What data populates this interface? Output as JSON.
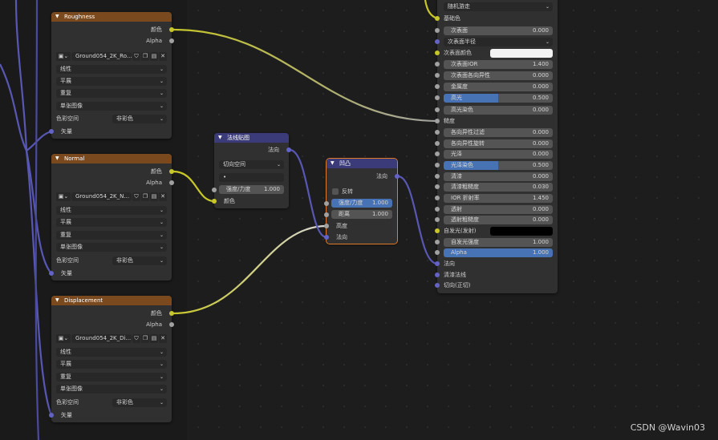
{
  "colors": {
    "texture_header": "#7a4a1e",
    "vector_header": "#3b3b79",
    "socket_color": "#c7c729",
    "socket_vector": "#6363c7",
    "socket_float": "#a1a1a1",
    "active_field": "#4772b3"
  },
  "roughness": {
    "title": "Roughness",
    "out_color": "颜色",
    "out_alpha": "Alpha",
    "image_name": "Ground054_2K_Ro...",
    "interpolation": "线性",
    "projection": "平展",
    "extension": "重复",
    "source": "单张图像",
    "colorspace_label": "色彩空间",
    "colorspace_value": "非彩色",
    "in_vector": "矢量"
  },
  "normal": {
    "title": "Normal",
    "out_color": "颜色",
    "out_alpha": "Alpha",
    "image_name": "Ground054_2K_N...",
    "interpolation": "线性",
    "projection": "平展",
    "extension": "重复",
    "source": "单张图像",
    "colorspace_label": "色彩空间",
    "colorspace_value": "非彩色",
    "in_vector": "矢量"
  },
  "displacement": {
    "title": "Displacement",
    "out_color": "颜色",
    "out_alpha": "Alpha",
    "image_name": "Ground054_2K_Di...",
    "interpolation": "线性",
    "projection": "平展",
    "extension": "重复",
    "source": "单张图像",
    "colorspace_label": "色彩空间",
    "colorspace_value": "非彩色",
    "in_vector": "矢量"
  },
  "normal_map": {
    "title": "法线贴图",
    "out_normal": "法向",
    "space": "切向空间",
    "uv_map": "•",
    "strength_label": "强度/力度",
    "strength_value": "1.000",
    "in_color": "颜色"
  },
  "bump": {
    "title": "凹凸",
    "out_normal": "法向",
    "invert_label": "反转",
    "strength_label": "强度/力度",
    "strength_value": "1.000",
    "strength_fraction": 1.0,
    "distance_label": "距离",
    "distance_value": "1.000",
    "in_height": "高度",
    "in_normal": "法向"
  },
  "bsdf": {
    "sss_method": "随机游走",
    "base_color": "基础色",
    "subsurface_label": "次表面",
    "subsurface_value": "0.000",
    "subsurface_radius": "次表面半径",
    "subsurface_color": "次表面颜色",
    "subsurface_ior_label": "次表面IOR",
    "subsurface_ior_value": "1.400",
    "subsurface_anisotropy_label": "次表面各向异性",
    "subsurface_anisotropy_value": "0.000",
    "metallic_label": "金属度",
    "metallic_value": "0.000",
    "specular_label": "高光",
    "specular_value": "0.500",
    "specular_fraction": 0.5,
    "specular_tint_label": "高光染色",
    "specular_tint_value": "0.000",
    "roughness_label": "糙度",
    "anisotropic_label": "各向异性过滤",
    "anisotropic_value": "0.000",
    "anisotropic_rotation_label": "各向异性旋转",
    "anisotropic_rotation_value": "0.000",
    "sheen_label": "光泽",
    "sheen_value": "0.000",
    "sheen_tint_label": "光泽染色",
    "sheen_tint_value": "0.500",
    "sheen_tint_fraction": 0.5,
    "clearcoat_label": "清漆",
    "clearcoat_value": "0.000",
    "clearcoat_roughness_label": "清漆粗糙度",
    "clearcoat_roughness_value": "0.030",
    "ior_label": "IOR 折射率",
    "ior_value": "1.450",
    "transmission_label": "透射",
    "transmission_value": "0.000",
    "transmission_roughness_label": "透射粗糙度",
    "transmission_roughness_value": "0.000",
    "emission_label": "自发光(发射)",
    "emission_strength_label": "自发光强度",
    "emission_strength_value": "1.000",
    "alpha_label": "Alpha",
    "alpha_value": "1.000",
    "alpha_fraction": 1.0,
    "normal_label": "法向",
    "clearcoat_normal_label": "清漆法线",
    "tangent_label": "切向(正切)"
  },
  "watermark": "CSDN @Wavin03"
}
